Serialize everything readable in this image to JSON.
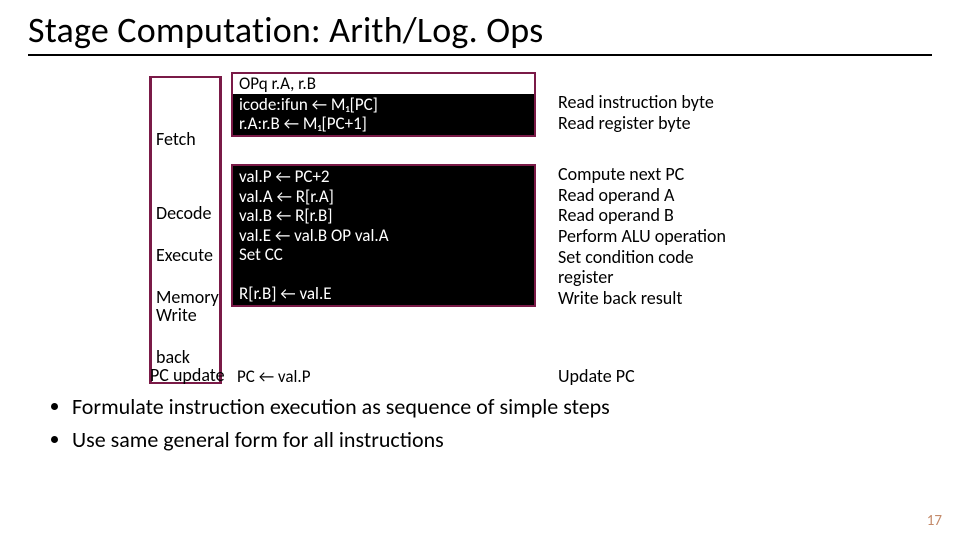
{
  "title": "Stage Computation: Arith/Log. Ops",
  "stages": {
    "fetch": "Fetch",
    "decode": "Decode",
    "execute": "Execute",
    "memory": "Memory",
    "write": "Write",
    "back": "back",
    "pcupdate": "PC update"
  },
  "code": {
    "box1_header": "OPq r.A, r.B",
    "box1_line1": "icode:ifun ← M₁[PC]",
    "box1_line2": "r.A:r.B ← M₁[PC+1]",
    "box2_line1": "val.P ← PC+2",
    "box2_line2": "val.A ← R[r.A]",
    "box2_line3": "val.B ← R[r.B]",
    "box2_line4": "val.E ← val.B OP val.A",
    "box2_line5": "Set CC",
    "box2_line6": "",
    "box2_line7": "R[r.B] ← val.E",
    "update_line": "PC ← val.P"
  },
  "desc": {
    "d1": "Read instruction byte\nRead register byte",
    "d2": "Compute next PC\nRead operand A\nRead operand B\nPerform ALU operation\nSet condition code\nregister\nWrite back result",
    "d3": "Update PC"
  },
  "bullets": [
    "Formulate instruction execution as sequence of simple steps",
    "Use same general form for all instructions"
  ],
  "pagenum": "17"
}
